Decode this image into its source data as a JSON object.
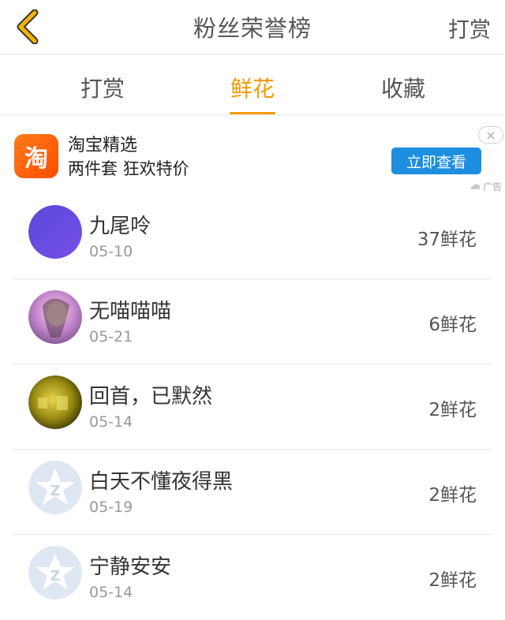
{
  "header": {
    "title": "粉丝荣誉榜",
    "right_action": "打赏"
  },
  "tabs": [
    {
      "label": "打赏",
      "active": false
    },
    {
      "label": "鲜花",
      "active": true
    },
    {
      "label": "收藏",
      "active": false
    }
  ],
  "ad": {
    "logo_char": "淘",
    "line1": "淘宝精选",
    "line2": "两件套 狂欢特价",
    "cta": "立即查看",
    "tag": "广告",
    "close": "×"
  },
  "list": [
    {
      "name": "九尾呤",
      "date": "05-10",
      "count": "37鲜花",
      "avatar": "purple"
    },
    {
      "name": "无喵喵喵",
      "date": "05-21",
      "count": "6鲜花",
      "avatar": "anime"
    },
    {
      "name": "回首，已默然",
      "date": "05-14",
      "count": "2鲜花",
      "avatar": "gold"
    },
    {
      "name": "白天不懂夜得黑",
      "date": "05-19",
      "count": "2鲜花",
      "avatar": "default-star"
    },
    {
      "name": "宁静安安",
      "date": "05-14",
      "count": "2鲜花",
      "avatar": "default-star"
    }
  ],
  "colors": {
    "accent": "#f59a00",
    "cta": "#1e8fe0",
    "divider": "#e8e8e8"
  }
}
